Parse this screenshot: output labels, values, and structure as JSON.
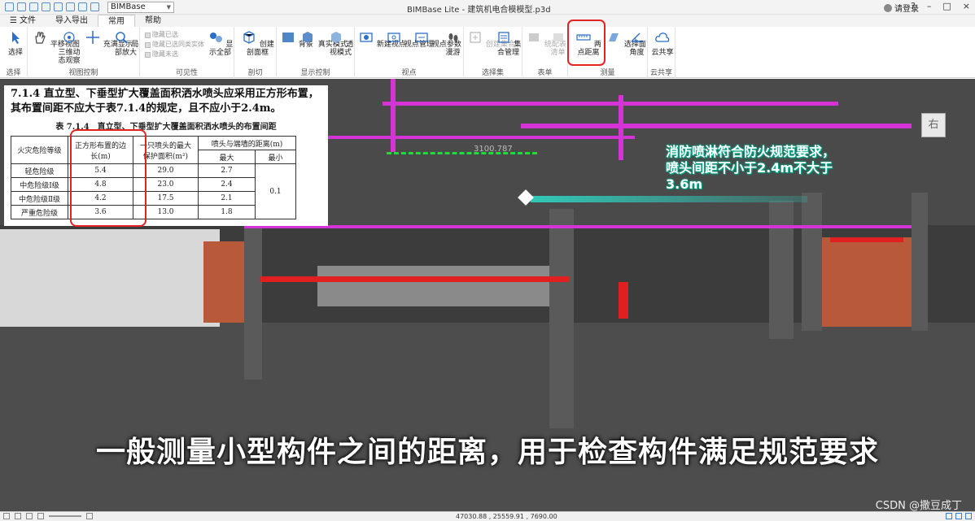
{
  "app": {
    "project_selector": "BIMBase",
    "window_title": "BIMBase Lite - 建筑机电合模模型.p3d",
    "login_label": "请登录",
    "window_controls": [
      "?",
      "–",
      "□",
      "×"
    ]
  },
  "menu": {
    "tabs": [
      {
        "label": "文件",
        "active": false
      },
      {
        "label": "导入导出",
        "active": false
      },
      {
        "label": "常用",
        "active": true
      },
      {
        "label": "帮助",
        "active": false
      }
    ]
  },
  "ribbon": {
    "groups": {
      "select": {
        "label": "选择",
        "buttons": [
          "选择"
        ]
      },
      "view_control": {
        "label": "视图控制",
        "buttons": [
          "平移视图",
          "三维动态观察",
          "充满显示",
          "局部放大"
        ]
      },
      "visibility": {
        "label": "可见性",
        "small_items": [
          "隐藏已选",
          "隐藏已选同类实体",
          "隐藏未选"
        ],
        "buttons": [
          "显示全部"
        ]
      },
      "section": {
        "label": "剖切",
        "buttons": [
          "创建剖面框"
        ]
      },
      "display": {
        "label": "显示控制",
        "buttons": [
          "背景",
          "真实模式",
          "透视模式"
        ]
      },
      "viewpoint": {
        "label": "视点",
        "buttons": [
          "新建视点",
          "视点管理",
          "视点参数",
          "漫游"
        ]
      },
      "selection_set": {
        "label": "选择集",
        "buttons": [
          "创建集合",
          "集合管理"
        ]
      },
      "table": {
        "label": "表单",
        "buttons": [
          "统配表",
          "清单"
        ]
      },
      "measure": {
        "label": "测量",
        "buttons": [
          "两点距离",
          "选择面",
          "角度"
        ]
      },
      "cloud": {
        "label": "云共享",
        "buttons": [
          "云共享"
        ]
      }
    }
  },
  "viewport": {
    "view_cube_label": "右",
    "measure_value": "3100.787",
    "annotation": "消防喷淋符合防火规范要求，喷头间距不小于2.4m不大于3.6m",
    "subtitle": "一般测量小型构件之间的距离，用于检查构件满足规范要求",
    "csdn_watermark": "CSDN @撒豆成丁"
  },
  "spec": {
    "clause_number": "7.1.4",
    "clause_text": "直立型、下垂型扩大覆盖面积洒水喷头应采用正方形布置，其布置间距不应大于表7.1.4的规定，且不应小于2.4m。",
    "table_caption": "表 7.1.4　直立型、下垂型扩大覆盖面积洒水喷头的布置间距",
    "headers": {
      "hazard": "火灾危险等级",
      "spacing": "正方形布置的边长(m)",
      "area": "一只喷头的最大保护面积(m²)",
      "distance": "喷头与端墙的距离(m)",
      "max": "最大",
      "min": "最小"
    },
    "rows": [
      {
        "hazard": "轻危险级",
        "spacing": "5.4",
        "area": "29.0",
        "max": "2.7"
      },
      {
        "hazard": "中危险级Ⅰ级",
        "spacing": "4.8",
        "area": "23.0",
        "max": "2.4"
      },
      {
        "hazard": "中危险级Ⅱ级",
        "spacing": "4.2",
        "area": "17.5",
        "max": "2.1"
      },
      {
        "hazard": "严重危险级",
        "spacing": "3.6",
        "area": "13.0",
        "max": "1.8"
      }
    ],
    "min_value": "0.1"
  },
  "status": {
    "coordinates": "47030.88 , 25559.91 , 7690.00"
  },
  "colors": {
    "accent_red": "#e32222",
    "sprinkler_pipe": "#d633d6",
    "fire_pipe": "#e02020",
    "measure_line": "#1fdc3b"
  }
}
